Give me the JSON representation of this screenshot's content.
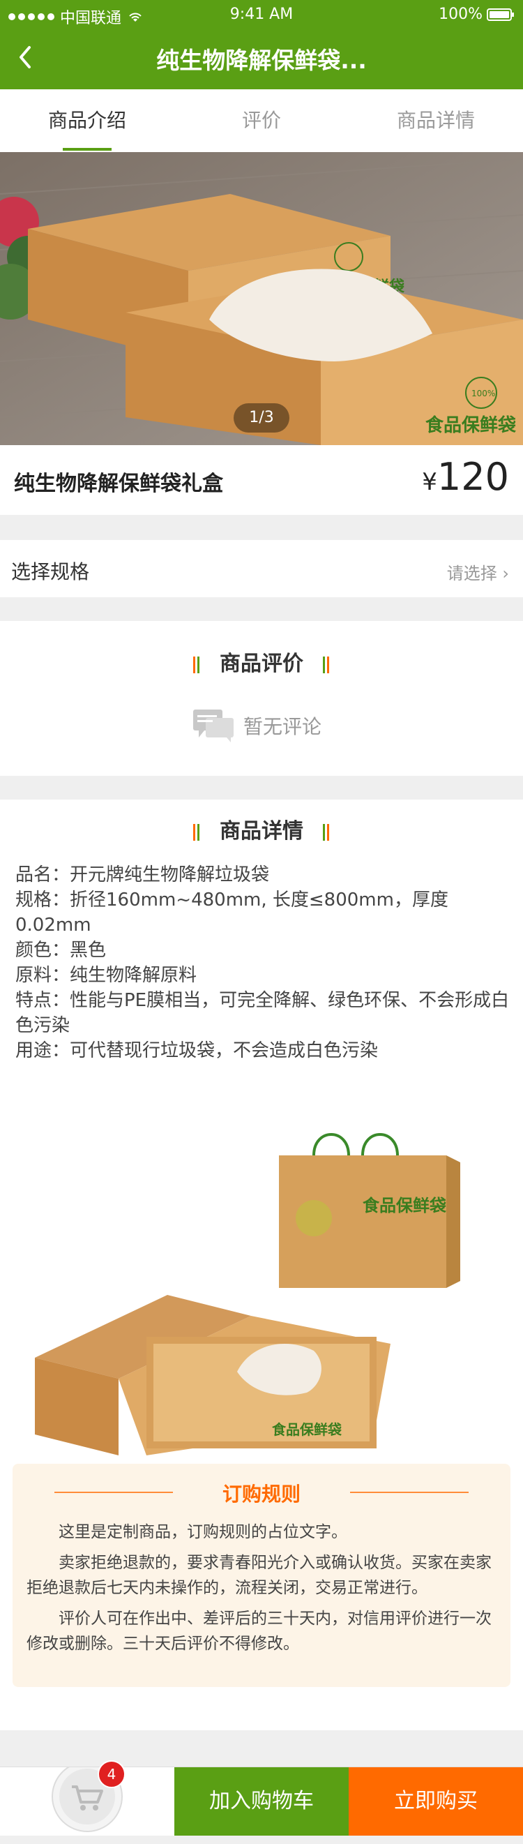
{
  "status_bar": {
    "carrier": "中国联通",
    "time": "9:41 AM",
    "battery": "100%"
  },
  "nav": {
    "title": "纯生物降解保鲜袋..."
  },
  "tabs": [
    {
      "label": "商品介绍",
      "active": true
    },
    {
      "label": "评价",
      "active": false
    },
    {
      "label": "商品详情",
      "active": false
    }
  ],
  "hero": {
    "pager": "1/3",
    "box_brand_text": "食品保鲜袋",
    "box_badge_text": "100%"
  },
  "product": {
    "name": "纯生物降解保鲜袋礼盒",
    "currency": "¥",
    "price": "120"
  },
  "spec": {
    "label": "选择规格",
    "value": "请选择 ›"
  },
  "reviews": {
    "title": "商品评价",
    "empty_text": "暂无评论"
  },
  "details": {
    "title": "商品详情",
    "lines": [
      "品名：开元牌纯生物降解垃圾袋",
      "规格：折径160mm~480mm, 长度≤800mm，厚度0.02mm",
      "颜色：黑色",
      "原料：纯生物降解原料",
      "特点：性能与PE膜相当，可完全降解、绿色环保、不会形成白色污染",
      "用途：可代替现行垃圾袋，不会造成白色污染"
    ],
    "image_brand_text": "食品保鲜袋"
  },
  "rules": {
    "title": "订购规则",
    "paragraphs": [
      "这里是定制商品，订购规则的占位文字。",
      "卖家拒绝退款的，要求青春阳光介入或确认收货。买家在卖家拒绝退款后七天内未操作的，流程关闭，交易正常进行。",
      "评价人可在作出中、差评后的三十天内，对信用评价进行一次修改或删除。三十天后评价不得修改。"
    ]
  },
  "bottom_bar": {
    "cart_count": "4",
    "add_to_cart": "加入购物车",
    "buy_now": "立即购买"
  },
  "colors": {
    "brand_green": "#5a9f14",
    "accent_orange": "#ff6a00",
    "badge_red": "#e02020"
  }
}
